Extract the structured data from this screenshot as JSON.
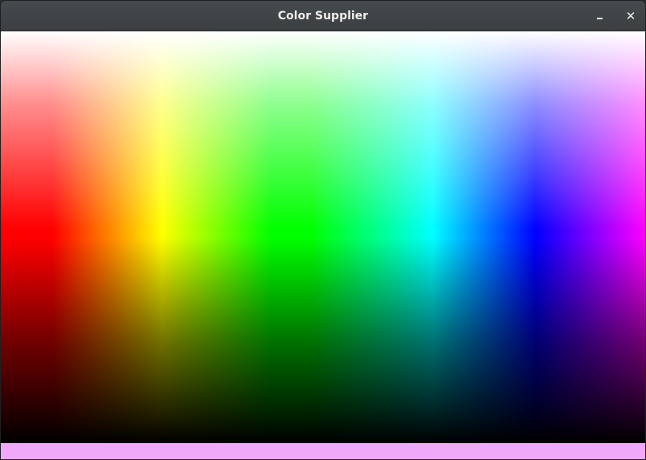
{
  "window": {
    "title": "Color Supplier",
    "minimize_icon": "minimize-icon",
    "close_icon": "close-icon",
    "close_glyph": "✕"
  },
  "picker": {
    "selected_color": "#f0a8f8"
  }
}
